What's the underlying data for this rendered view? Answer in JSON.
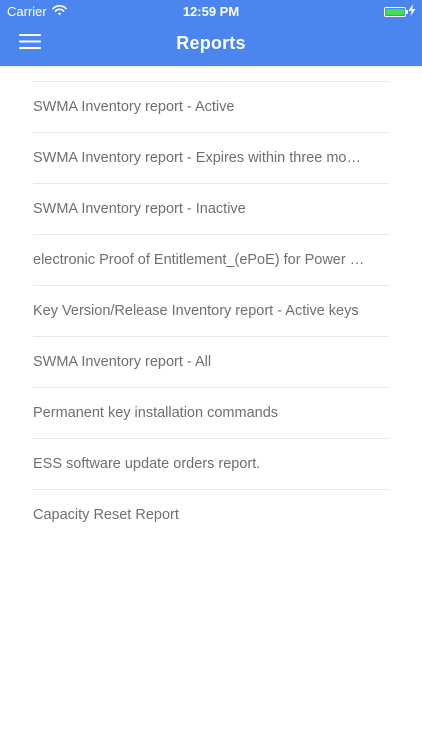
{
  "status_bar": {
    "carrier": "Carrier",
    "time": "12:59 PM",
    "battery_color": "#3ee04c"
  },
  "nav": {
    "title": "Reports",
    "menu_icon": "hamburger-menu-icon",
    "background_color": "#4a86ee"
  },
  "reports": [
    {
      "label": "SWMA Inventory report - Active"
    },
    {
      "label": "SWMA Inventory report - Expires within three months"
    },
    {
      "label": "SWMA Inventory report - Inactive"
    },
    {
      "label": "electronic Proof of Entitlement_(ePoE) for Power report"
    },
    {
      "label": "Key Version/Release Inventory report - Active keys"
    },
    {
      "label": "SWMA Inventory report - All"
    },
    {
      "label": "Permanent key installation commands"
    },
    {
      "label": "ESS software update orders report."
    },
    {
      "label": "Capacity Reset Report"
    }
  ]
}
